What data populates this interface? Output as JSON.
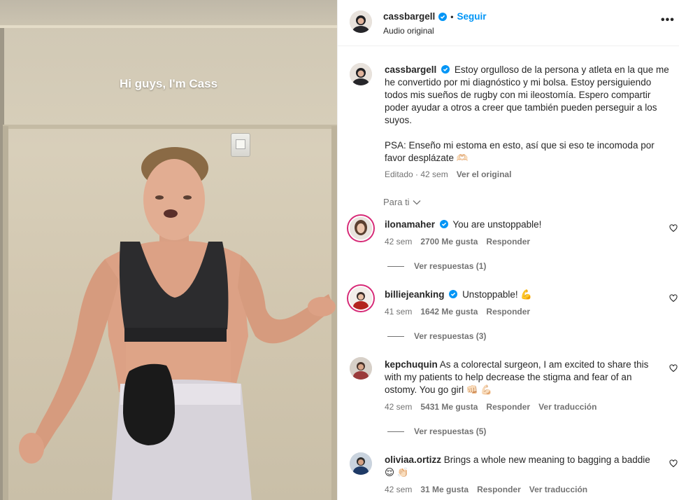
{
  "video": {
    "caption": "Hi guys, I'm Cass"
  },
  "header": {
    "username": "cassbargell",
    "separator": "•",
    "follow_label": "Seguir",
    "audio": "Audio original",
    "more_label": "•••"
  },
  "post_caption": {
    "username": "cassbargell",
    "text": "Estoy orgulloso de la persona y atleta en la que me he convertido por mi diagnóstico y mi bolsa. Estoy persiguiendo todos mis sueños de rugby con mi ileostomía. Espero compartir poder ayudar a otros a creer que también pueden perseguir a los suyos.",
    "psa": "PSA: Enseño mi estoma en esto, así que si eso te incomoda por favor desplázate 🫶🏻",
    "edited": "Editado · 42 sem",
    "see_original": "Ver el original"
  },
  "sort": {
    "label": "Para ti"
  },
  "comments": [
    {
      "username": "ilonamaher",
      "verified": true,
      "text": "You are unstoppable!",
      "time": "42 sem",
      "likes": "2700 Me gusta",
      "reply": "Responder",
      "translate": "",
      "view_replies": "Ver respuestas (1)"
    },
    {
      "username": "billiejeanking",
      "verified": true,
      "text": "Unstoppable! 💪",
      "time": "41 sem",
      "likes": "1642 Me gusta",
      "reply": "Responder",
      "translate": "",
      "view_replies": "Ver respuestas (3)"
    },
    {
      "username": "kepchuquin",
      "verified": false,
      "text": "As a colorectal surgeon, I am excited to share this with my patients to help decrease the stigma and fear of an ostomy. You go girl 👊🏻 💪🏻",
      "time": "42 sem",
      "likes": "5431 Me gusta",
      "reply": "Responder",
      "translate": "Ver traducción",
      "view_replies": "Ver respuestas (5)"
    },
    {
      "username": "oliviaa.ortizz",
      "verified": false,
      "text": "Brings a whole new meaning to bagging a baddie 😌 👏🏻",
      "time": "42 sem",
      "likes": "31 Me gusta",
      "reply": "Responder",
      "translate": "Ver traducción",
      "view_replies": ""
    }
  ],
  "colors": {
    "accent": "#0095f6",
    "secondary_text": "#737373",
    "verified": "#0095f6"
  }
}
